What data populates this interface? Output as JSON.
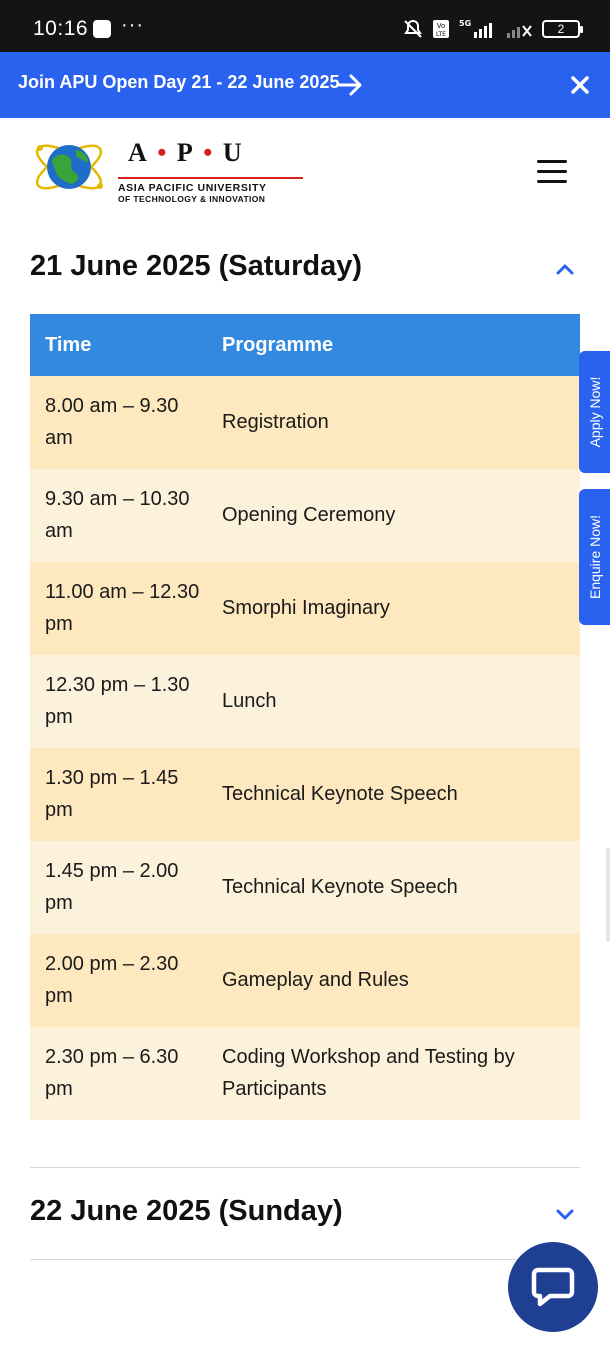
{
  "status_bar": {
    "time": "10:16",
    "more": "···",
    "network": "5G",
    "battery": "2"
  },
  "announcement": {
    "text": "Join APU Open Day 21 - 22 June 2025"
  },
  "logo": {
    "title_a": "A",
    "title_p": "P",
    "title_u": "U",
    "line1": "ASIA PACIFIC UNIVERSITY",
    "line2": "OF TECHNOLOGY & INNOVATION"
  },
  "day1": {
    "title": "21 June 2025 (Saturday)",
    "headers": {
      "time": "Time",
      "programme": "Programme"
    },
    "rows": [
      {
        "time": "8.00 am – 9.30 am",
        "programme": "Registration"
      },
      {
        "time": "9.30 am – 10.30 am",
        "programme": "Opening Ceremony"
      },
      {
        "time": "11.00 am – 12.30 pm",
        "programme": "Smorphi Imaginary"
      },
      {
        "time": "12.30 pm – 1.30 pm",
        "programme": "Lunch"
      },
      {
        "time": "1.30 pm – 1.45 pm",
        "programme": "Technical Keynote Speech"
      },
      {
        "time": "1.45 pm – 2.00 pm",
        "programme": "Technical Keynote Speech"
      },
      {
        "time": "2.00 pm – 2.30 pm",
        "programme": "Gameplay and Rules"
      },
      {
        "time": "2.30 pm – 6.30 pm",
        "programme": "Coding Workshop and Testing by Participants"
      }
    ]
  },
  "day2": {
    "title": "22 June 2025 (Sunday)"
  },
  "side_tabs": {
    "apply": "Apply Now!",
    "enquire": "Enquire Now!"
  },
  "colors": {
    "brand_blue": "#2a62f0",
    "table_header": "#3389e0",
    "row_odd": "#fde8bf",
    "row_even": "#fcf2dc",
    "chat_button": "#1f3f93",
    "logo_red": "#d62020"
  },
  "icons": {
    "announcement_arrow": "arrow-right-icon",
    "announcement_close": "close-icon",
    "menu": "hamburger-icon",
    "day1_toggle": "chevron-up-icon",
    "day2_toggle": "chevron-down-icon",
    "chat": "chat-bubble-icon"
  }
}
